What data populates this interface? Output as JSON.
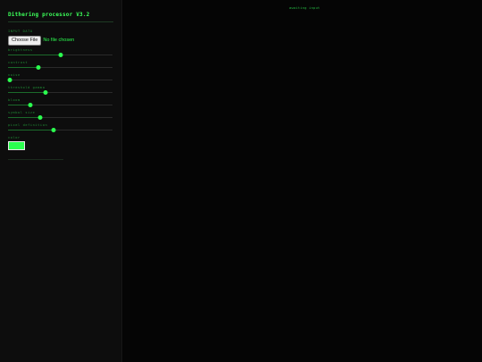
{
  "app": {
    "title": "Dithering processor V3.2"
  },
  "input": {
    "label": "INPUT DATA",
    "button_label": "Choose File",
    "status": "No file chosen"
  },
  "controls": [
    {
      "label": "brightness",
      "value": 0.5
    },
    {
      "label": "contrast",
      "value": 0.29
    },
    {
      "label": "noise",
      "value": 0.02
    },
    {
      "label": "threshold gamma",
      "value": 0.36
    },
    {
      "label": "bloom",
      "value": 0.21
    },
    {
      "label": "symbol size",
      "value": 0.31
    },
    {
      "label": "pixel definition",
      "value": 0.44
    }
  ],
  "color": {
    "label": "color",
    "value": "#2bff4f"
  },
  "canvas": {
    "status": "awaiting input"
  },
  "colors": {
    "accent": "#2bff4f",
    "sidebar_bg": "#0d0d0d",
    "canvas_bg": "#050505"
  }
}
